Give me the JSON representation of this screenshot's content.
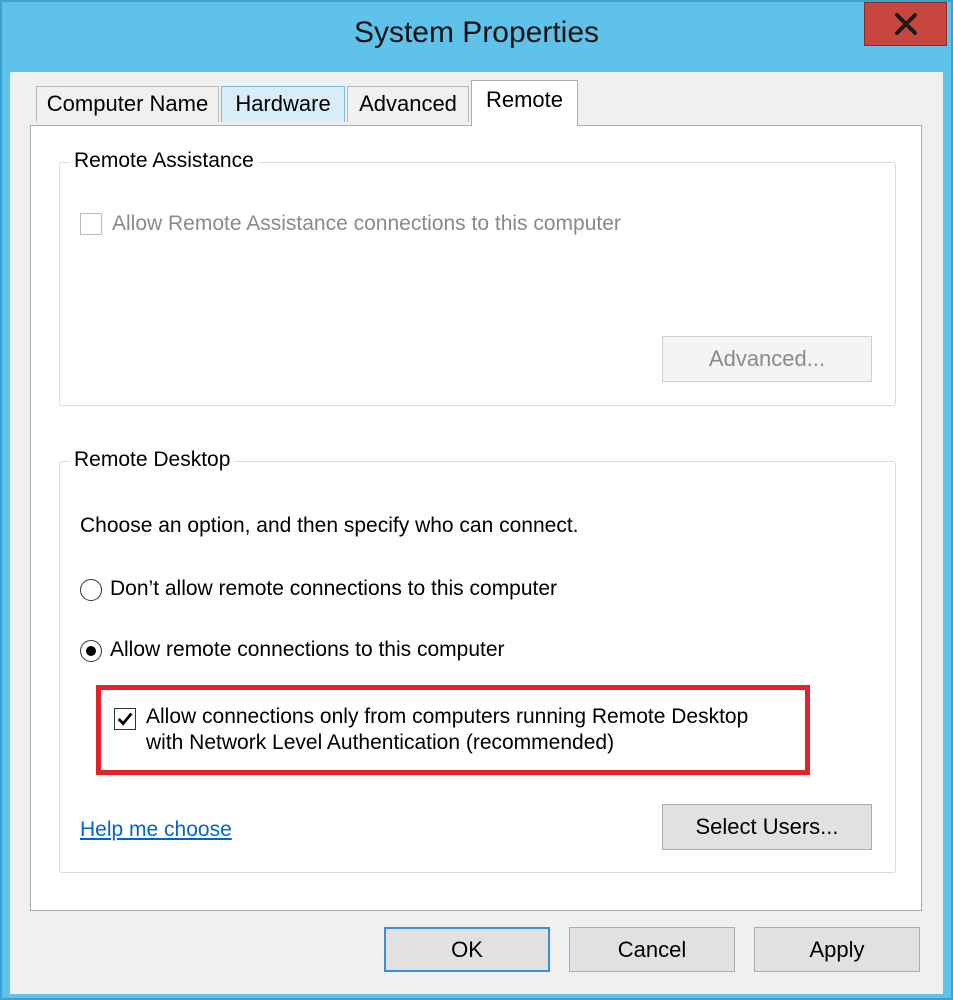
{
  "window": {
    "title": "System Properties",
    "close_label": "X"
  },
  "tabs": [
    {
      "label": "Computer Name",
      "state": "normal"
    },
    {
      "label": "Hardware",
      "state": "hover"
    },
    {
      "label": "Advanced",
      "state": "normal"
    },
    {
      "label": "Remote",
      "state": "active"
    }
  ],
  "remote_assistance": {
    "legend": "Remote Assistance",
    "allow_label": "Allow Remote Assistance connections to this computer",
    "allow_checked": false,
    "advanced_button": "Advanced..."
  },
  "remote_desktop": {
    "legend": "Remote Desktop",
    "instruction": "Choose an option, and then specify who can connect.",
    "options": [
      {
        "label": "Don’t allow remote connections to this computer",
        "selected": false
      },
      {
        "label": "Allow remote connections to this computer",
        "selected": true
      }
    ],
    "nla_label_line1": "Allow connections only from computers running Remote Desktop",
    "nla_label_line2": "with Network Level Authentication (recommended)",
    "nla_checked": true,
    "help_link": "Help me choose",
    "select_users_button": "Select Users..."
  },
  "footer": {
    "ok": "OK",
    "cancel": "Cancel",
    "apply": "Apply"
  },
  "colors": {
    "titlebar": "#5fc2ea",
    "close": "#c7463f",
    "highlight": "#e3232b",
    "link": "#0066cc"
  }
}
